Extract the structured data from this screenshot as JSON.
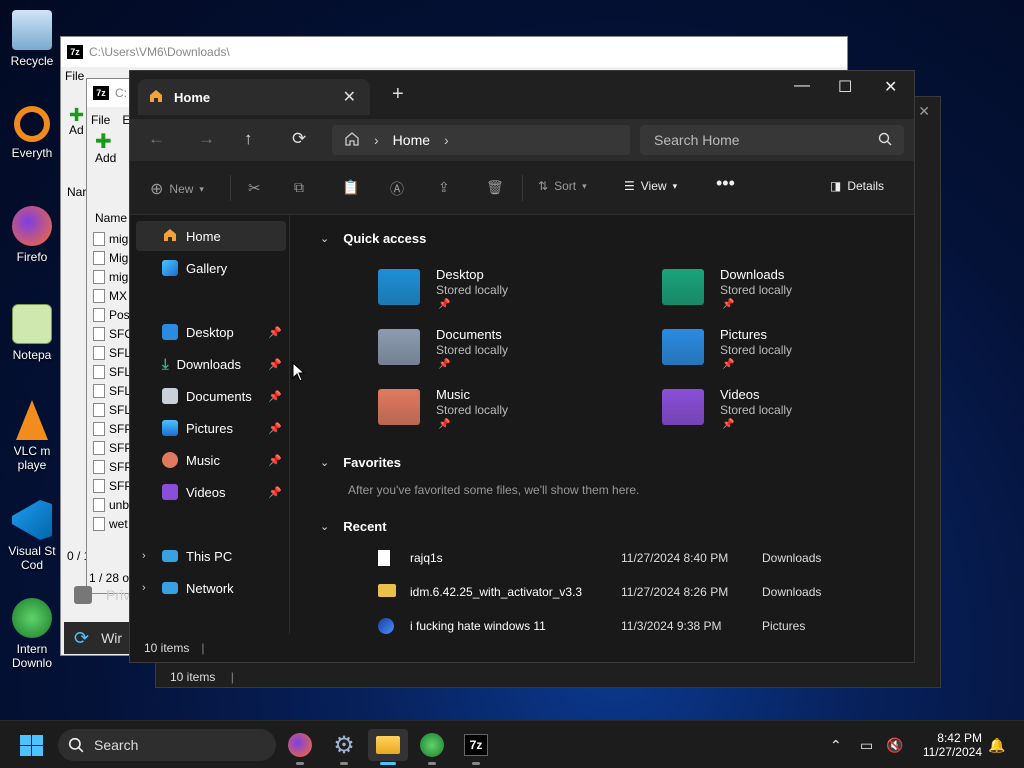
{
  "desktop": {
    "icons": [
      {
        "label": "Recycle",
        "name": "recycle-bin-icon"
      },
      {
        "label": "Everyth",
        "name": "everything-icon"
      },
      {
        "label": "Firefo",
        "name": "firefox-desktop-icon"
      },
      {
        "label": "Notepa",
        "name": "notepad-icon"
      },
      {
        "label": "VLC m",
        "label2": "playe",
        "name": "vlc-icon"
      },
      {
        "label": "Visual St",
        "label2": "Cod",
        "name": "vscode-icon"
      },
      {
        "label": "Intern",
        "label2": "Downlo",
        "name": "idm-icon"
      }
    ]
  },
  "sevenzip_back": {
    "title1": "C:\\Users\\VM6\\Downloads\\",
    "title2": "C:",
    "menu_file": "File",
    "menu_edit": "E",
    "add": "Add",
    "add_short": "Ad",
    "col_name": "Name",
    "col_name_short": "Nar",
    "rows": [
      "mig",
      "Mig",
      "mig",
      "MX",
      "Pos",
      "SFO",
      "SFL",
      "SFL",
      "SFL",
      "SFL",
      "SFP",
      "SFP",
      "SFP",
      "SFP",
      "unb",
      "wet"
    ],
    "status1": "0 / 1",
    "status2": "1 / 28 ob",
    "privacy": "Priv",
    "win": "Wir"
  },
  "back_window": {
    "status": "10 items"
  },
  "explorer": {
    "tab_title": "Home",
    "breadcrumb": "Home",
    "search_placeholder": "Search Home",
    "toolbar": {
      "new": "New",
      "sort": "Sort",
      "view": "View",
      "details": "Details"
    },
    "sidebar": {
      "home": "Home",
      "gallery": "Gallery",
      "desktop": "Desktop",
      "downloads": "Downloads",
      "documents": "Documents",
      "pictures": "Pictures",
      "music": "Music",
      "videos": "Videos",
      "this_pc": "This PC",
      "network": "Network"
    },
    "quick_access_title": "Quick access",
    "quick_access": [
      {
        "name": "Desktop",
        "sub": "Stored locally",
        "color": "#1e8fd6"
      },
      {
        "name": "Downloads",
        "sub": "Stored locally",
        "color": "#1aa37a"
      },
      {
        "name": "Documents",
        "sub": "Stored locally",
        "color": "#8c9bb0"
      },
      {
        "name": "Pictures",
        "sub": "Stored locally",
        "color": "#2a8be0"
      },
      {
        "name": "Music",
        "sub": "Stored locally",
        "color": "#e07a5f"
      },
      {
        "name": "Videos",
        "sub": "Stored locally",
        "color": "#8a4fd8"
      }
    ],
    "favorites_title": "Favorites",
    "favorites_empty": "After you've favorited some files, we'll show them here.",
    "recent_title": "Recent",
    "recent": [
      {
        "name": "rajq1s",
        "date": "11/27/2024 8:40 PM",
        "location": "Downloads"
      },
      {
        "name": "idm.6.42.25_with_activator_v3.3",
        "date": "11/27/2024 8:26 PM",
        "location": "Downloads"
      },
      {
        "name": "i fucking hate windows 11",
        "date": "11/3/2024 9:38 PM",
        "location": "Pictures"
      }
    ],
    "status": "10 items"
  },
  "taskbar": {
    "search": "Search",
    "time": "8:42 PM",
    "date": "11/27/2024",
    "apps": [
      "firefox",
      "settings",
      "file-explorer",
      "idm",
      "7-zip"
    ]
  }
}
